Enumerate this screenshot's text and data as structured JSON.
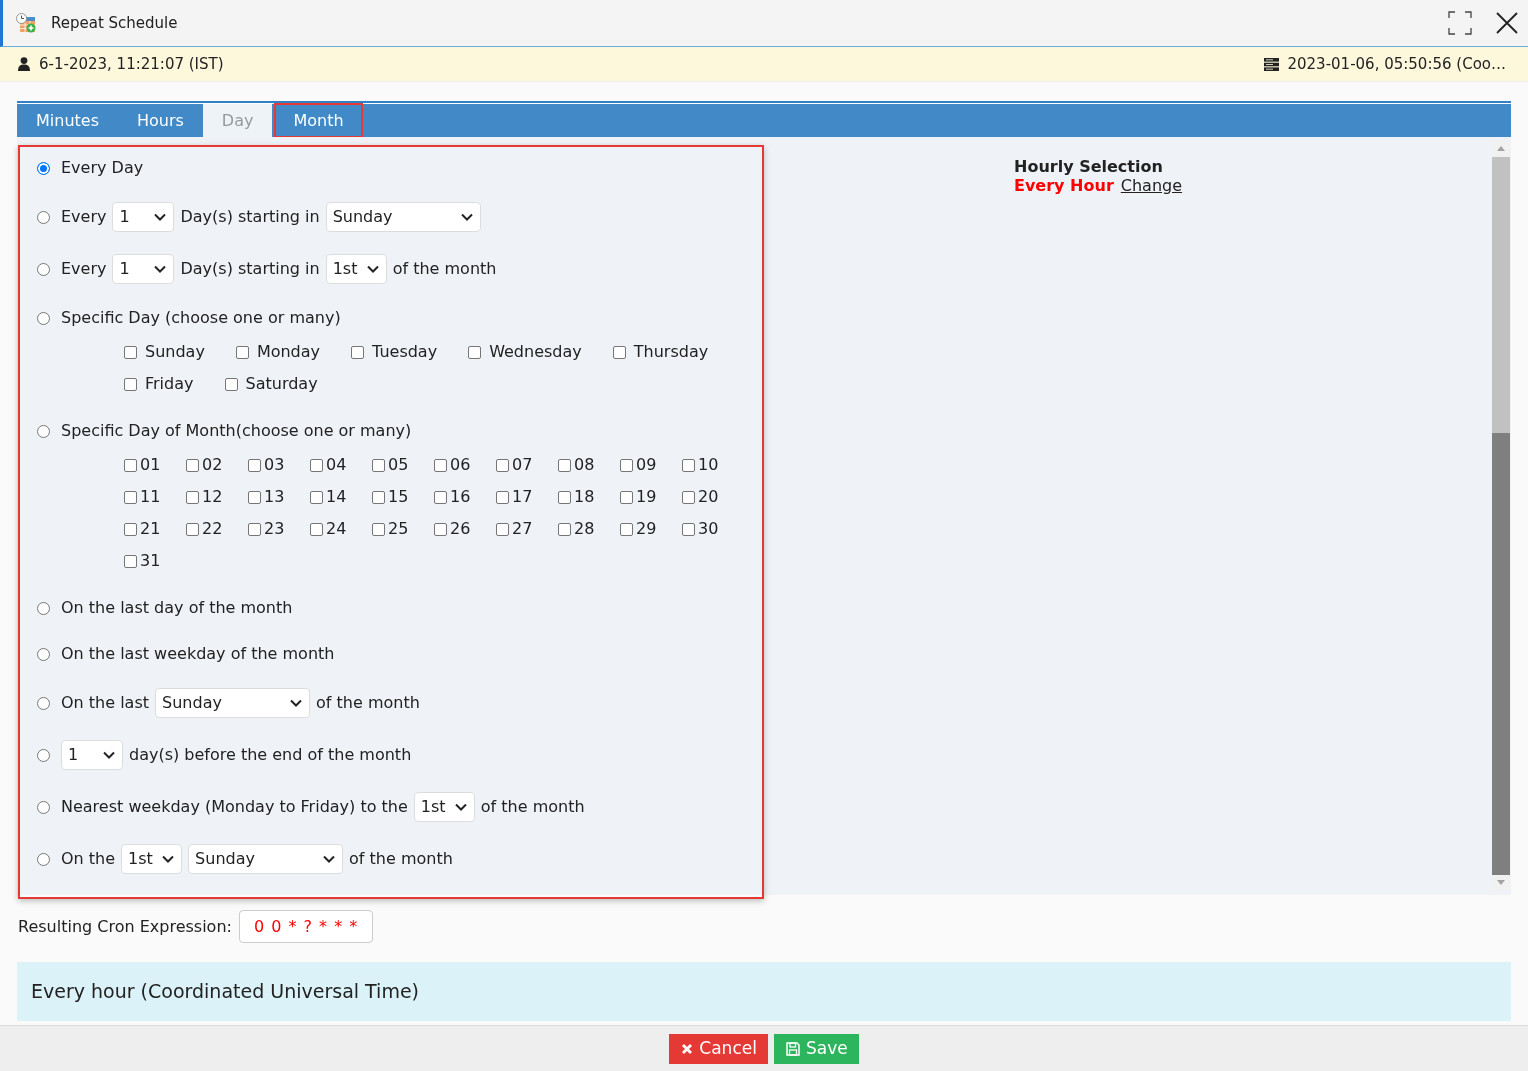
{
  "window": {
    "title": "Repeat Schedule"
  },
  "info_bar": {
    "local_time": "6-1-2023, 11:21:07 (IST)",
    "server_time": "2023-01-06, 05:50:56 (Coo…"
  },
  "tabs": [
    {
      "label": "Minutes",
      "selected": false,
      "highlighted": false
    },
    {
      "label": "Hours",
      "selected": false,
      "highlighted": false
    },
    {
      "label": "Day",
      "selected": true,
      "highlighted": false
    },
    {
      "label": "Month",
      "selected": false,
      "highlighted": true
    }
  ],
  "options_panel": {
    "highlighted": true,
    "options": [
      {
        "kind": "inline",
        "selected": true,
        "parts": [
          {
            "kind": "text",
            "text": "Every Day"
          }
        ]
      },
      {
        "kind": "inline",
        "selected": false,
        "parts": [
          {
            "kind": "text",
            "text": "Every"
          },
          {
            "kind": "number_select",
            "value": "1"
          },
          {
            "kind": "text",
            "text": "Day(s) starting in"
          },
          {
            "kind": "weekday_select",
            "value": "Sunday"
          }
        ]
      },
      {
        "kind": "inline",
        "selected": false,
        "parts": [
          {
            "kind": "text",
            "text": "Every"
          },
          {
            "kind": "number_select",
            "value": "1"
          },
          {
            "kind": "text",
            "text": "Day(s) starting in"
          },
          {
            "kind": "ordinal_select",
            "value": "1st"
          },
          {
            "kind": "text",
            "text": "of the month"
          }
        ]
      },
      {
        "kind": "weekday_checkboxes",
        "selected": false,
        "parts": [
          {
            "kind": "text",
            "text": "Specific Day (choose one or many)"
          }
        ],
        "checkboxes": [
          {
            "label": "Sunday",
            "checked": false
          },
          {
            "label": "Monday",
            "checked": false
          },
          {
            "label": "Tuesday",
            "checked": false
          },
          {
            "label": "Wednesday",
            "checked": false
          },
          {
            "label": "Thursday",
            "checked": false
          },
          {
            "label": "Friday",
            "checked": false
          },
          {
            "label": "Saturday",
            "checked": false
          }
        ]
      },
      {
        "kind": "monthday_checkboxes",
        "selected": false,
        "parts": [
          {
            "kind": "text",
            "text": "Specific Day of Month(choose one or many)"
          }
        ],
        "checkboxes": [
          {
            "label": "01",
            "checked": false
          },
          {
            "label": "02",
            "checked": false
          },
          {
            "label": "03",
            "checked": false
          },
          {
            "label": "04",
            "checked": false
          },
          {
            "label": "05",
            "checked": false
          },
          {
            "label": "06",
            "checked": false
          },
          {
            "label": "07",
            "checked": false
          },
          {
            "label": "08",
            "checked": false
          },
          {
            "label": "09",
            "checked": false
          },
          {
            "label": "10",
            "checked": false
          },
          {
            "label": "11",
            "checked": false
          },
          {
            "label": "12",
            "checked": false
          },
          {
            "label": "13",
            "checked": false
          },
          {
            "label": "14",
            "checked": false
          },
          {
            "label": "15",
            "checked": false
          },
          {
            "label": "16",
            "checked": false
          },
          {
            "label": "17",
            "checked": false
          },
          {
            "label": "18",
            "checked": false
          },
          {
            "label": "19",
            "checked": false
          },
          {
            "label": "20",
            "checked": false
          },
          {
            "label": "21",
            "checked": false
          },
          {
            "label": "22",
            "checked": false
          },
          {
            "label": "23",
            "checked": false
          },
          {
            "label": "24",
            "checked": false
          },
          {
            "label": "25",
            "checked": false
          },
          {
            "label": "26",
            "checked": false
          },
          {
            "label": "27",
            "checked": false
          },
          {
            "label": "28",
            "checked": false
          },
          {
            "label": "29",
            "checked": false
          },
          {
            "label": "30",
            "checked": false
          },
          {
            "label": "31",
            "checked": false
          }
        ]
      },
      {
        "kind": "inline",
        "selected": false,
        "parts": [
          {
            "kind": "text",
            "text": "On the last day of the month"
          }
        ]
      },
      {
        "kind": "inline",
        "selected": false,
        "parts": [
          {
            "kind": "text",
            "text": "On the last weekday of the month"
          }
        ]
      },
      {
        "kind": "inline",
        "selected": false,
        "parts": [
          {
            "kind": "text",
            "text": "On the last"
          },
          {
            "kind": "weekday_select",
            "value": "Sunday"
          },
          {
            "kind": "text",
            "text": "of the month"
          }
        ]
      },
      {
        "kind": "inline",
        "selected": false,
        "parts": [
          {
            "kind": "number_select",
            "value": "1"
          },
          {
            "kind": "text",
            "text": "day(s) before the end of the month"
          }
        ]
      },
      {
        "kind": "inline",
        "selected": false,
        "parts": [
          {
            "kind": "text",
            "text": "Nearest weekday (Monday to Friday) to the"
          },
          {
            "kind": "ordinal_select",
            "value": "1st"
          },
          {
            "kind": "text",
            "text": "of the month"
          }
        ]
      },
      {
        "kind": "inline",
        "selected": false,
        "parts": [
          {
            "kind": "text",
            "text": "On the"
          },
          {
            "kind": "ordinal_select",
            "value": "1st"
          },
          {
            "kind": "weekday_select",
            "value": "Sunday"
          },
          {
            "kind": "text",
            "text": "of the month"
          }
        ]
      }
    ]
  },
  "hourly_selection": {
    "title": "Hourly Selection",
    "value": "Every Hour",
    "link": "Change"
  },
  "cron": {
    "label": "Resulting Cron Expression:",
    "value": "0 0 * ? * * *"
  },
  "description": "Every hour (Coordinated Universal Time)",
  "buttons": [
    {
      "kind": "cancel",
      "label": "Cancel"
    },
    {
      "kind": "save",
      "label": "Save"
    }
  ]
}
